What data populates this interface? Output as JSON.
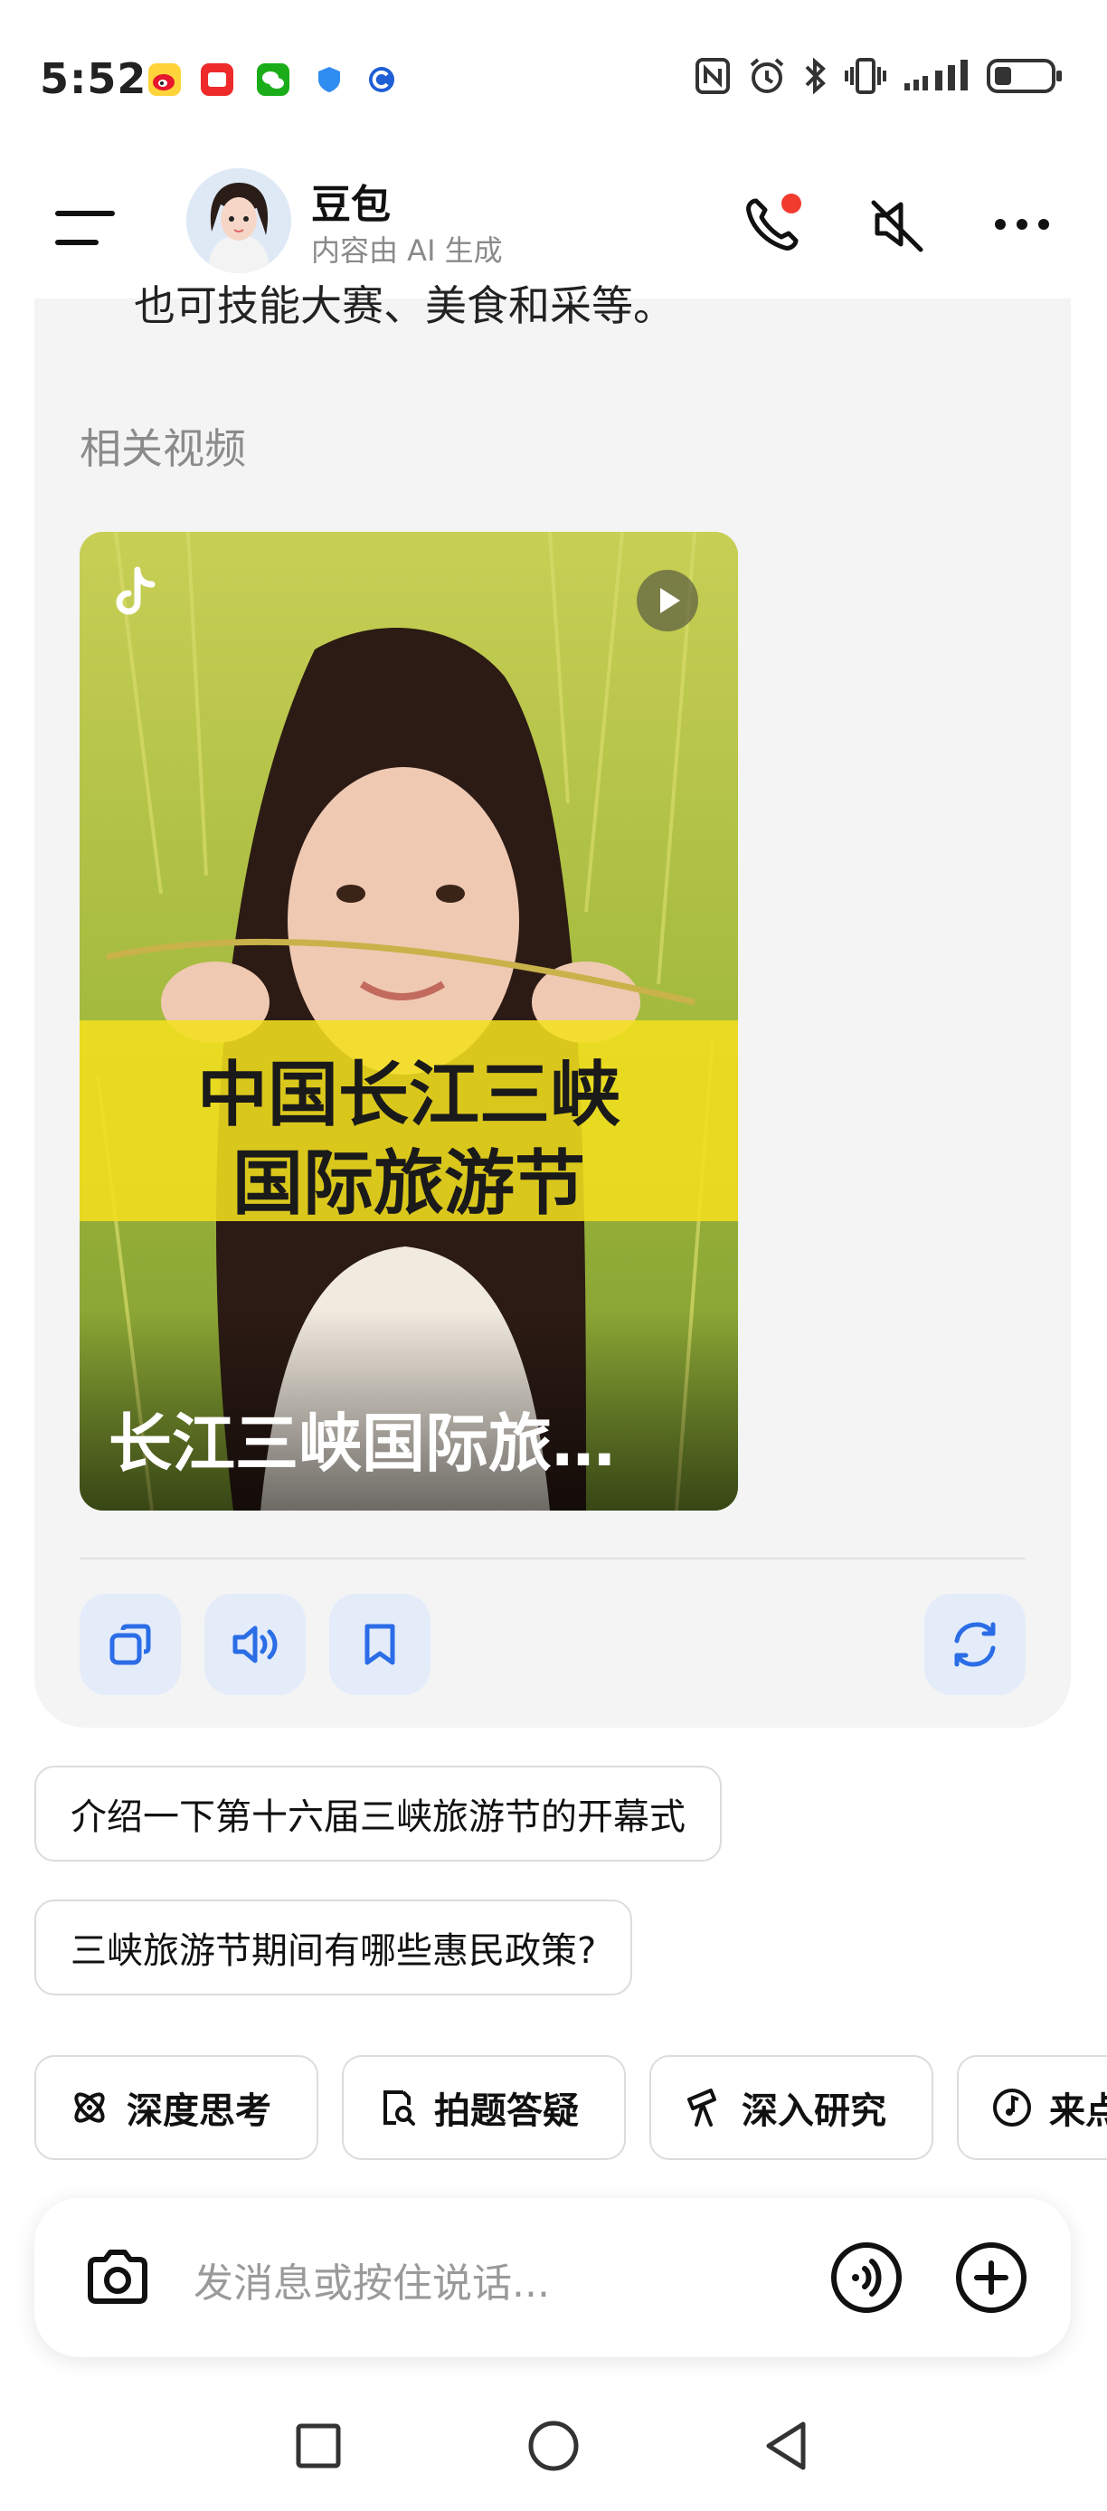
{
  "status_bar": {
    "time": "5:52",
    "notification_icons": [
      "weibo-icon",
      "red-app-icon",
      "wechat-icon",
      "shield-icon",
      "c-app-icon"
    ],
    "system_icons": [
      "nfc-icon",
      "alarm-icon",
      "bluetooth-icon",
      "vibrate-icon",
      "signal-icon",
      "battery-icon"
    ]
  },
  "header": {
    "bot_name": "豆包",
    "subtitle": "内容由 AI 生成",
    "icons": [
      "menu-icon",
      "phone-call-icon",
      "mute-icon",
      "more-icon"
    ]
  },
  "message": {
    "clipped_text": "也可技能大赛、美食和采等。",
    "related_label": "相关视频",
    "video": {
      "banner_line1": "中国长江三峡",
      "banner_line2": "国际旅游节",
      "caption": "长江三峡国际旅…",
      "icons": [
        "tiktok-icon",
        "play-icon"
      ]
    },
    "actions": [
      "copy-icon",
      "speaker-icon",
      "bookmark-icon",
      "regenerate-icon"
    ]
  },
  "suggestions": [
    "介绍一下第十六届三峡旅游节的开幕式",
    "三峡旅游节期间有哪些惠民政策?"
  ],
  "tools": [
    {
      "label": "深度思考",
      "icon": "atom-icon"
    },
    {
      "label": "拍题答疑",
      "icon": "search-doc-icon"
    },
    {
      "label": "深入研究",
      "icon": "telescope-icon"
    },
    {
      "label": "来点",
      "icon": "music-icon"
    }
  ],
  "input": {
    "placeholder": "发消息或按住说话...",
    "icons": [
      "camera-icon",
      "voice-icon",
      "plus-icon"
    ]
  },
  "nav": [
    "recents-square-icon",
    "home-circle-icon",
    "back-triangle-icon"
  ],
  "colors": {
    "accent_blue": "#2b6de6",
    "action_bg": "#e4ecfa",
    "card_bg": "#f4f4f5",
    "banner_yellow": "#f2df1e",
    "call_dot_red": "#f03b2e"
  }
}
